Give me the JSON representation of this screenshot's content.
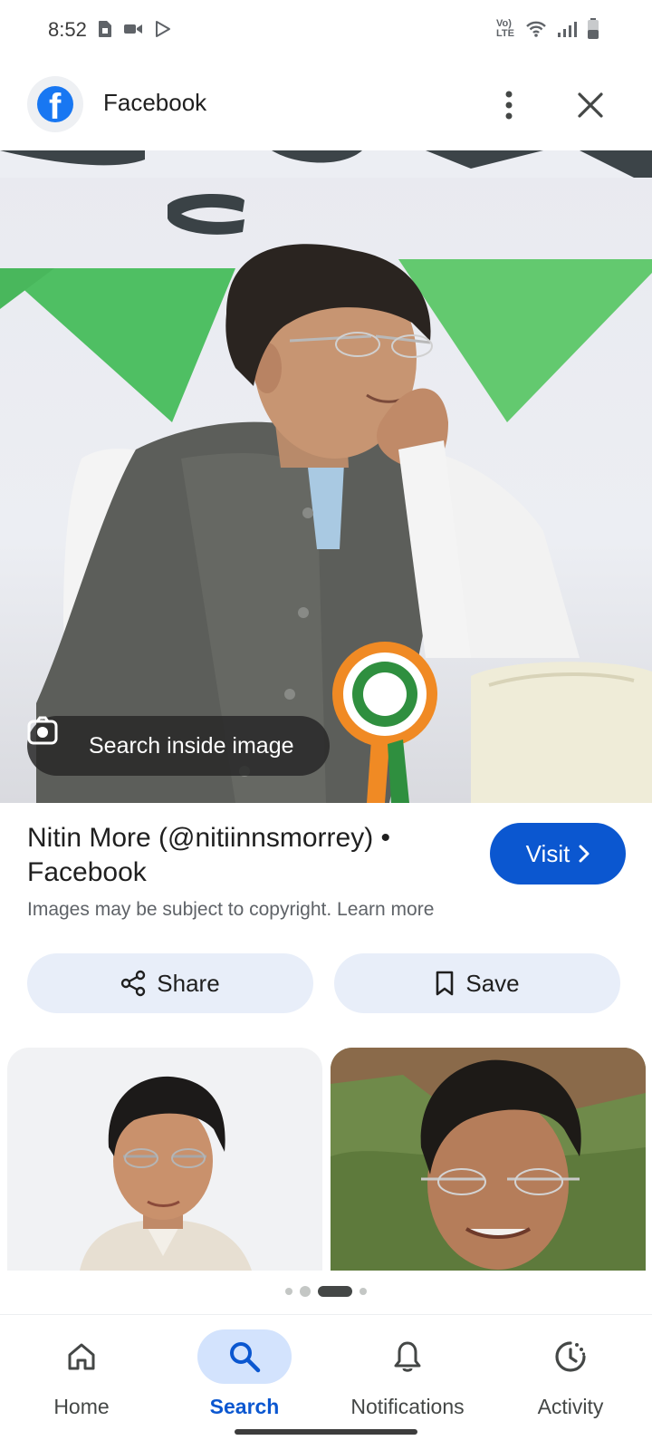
{
  "status_bar": {
    "time": "8:52",
    "left_icons": [
      "sim-card-icon",
      "video-icon",
      "play-store-icon"
    ],
    "right_icons": [
      "volte-icon",
      "wifi-icon",
      "signal-icon",
      "battery-icon"
    ],
    "volte_text": "Vo) LTE"
  },
  "top_bar": {
    "source_icon": "facebook-icon",
    "title": "Facebook",
    "more_icon": "more-vert-icon",
    "close_icon": "close-icon"
  },
  "hero": {
    "lens_chip_label": "Search inside image",
    "lens_icon": "lens-icon"
  },
  "result": {
    "title": "Nitin More (@nitiinnsmorrey) • Facebook",
    "visit_label": "Visit",
    "copyright_text": "Images may be subject to copyright.",
    "learn_more": "Learn more"
  },
  "actions": {
    "share_label": "Share",
    "save_label": "Save"
  },
  "pager": {
    "count": 4,
    "active_index": 2
  },
  "bottom_nav": {
    "items": [
      {
        "label": "Home",
        "icon": "home-icon"
      },
      {
        "label": "Search",
        "icon": "search-icon"
      },
      {
        "label": "Notifications",
        "icon": "bell-icon"
      },
      {
        "label": "Activity",
        "icon": "activity-icon"
      }
    ],
    "active_index": 1
  },
  "colors": {
    "accent": "#0b57d0",
    "accent_light": "#d3e3fd",
    "chip_bg": "#e8eef9",
    "facebook_blue": "#1877f2"
  }
}
